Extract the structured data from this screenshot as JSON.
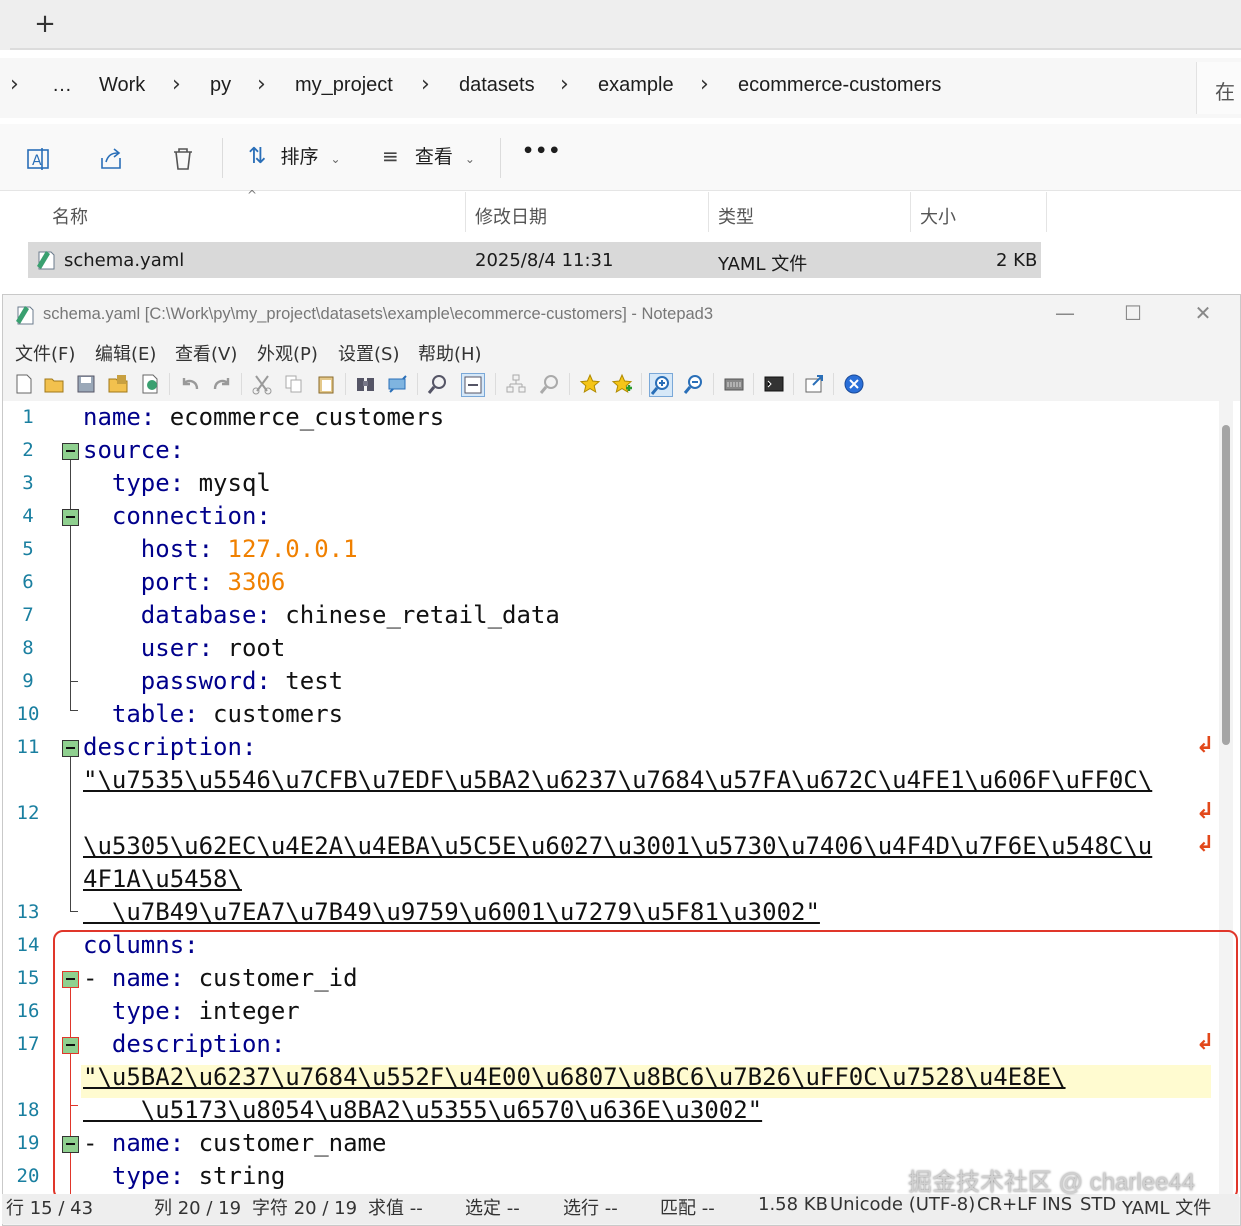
{
  "explorer": {
    "new_tab_label": "+",
    "breadcrumb": [
      "…",
      "Work",
      "py",
      "my_project",
      "datasets",
      "example",
      "ecommerce-customers"
    ],
    "address_right": "在",
    "commands": {
      "sort": "排序",
      "view": "查看",
      "more": "•••"
    },
    "columns": {
      "name": "名称",
      "modified": "修改日期",
      "type": "类型",
      "size": "大小"
    },
    "file": {
      "name": "schema.yaml",
      "modified": "2025/8/4 11:31",
      "type": "YAML 文件",
      "size": "2 KB"
    }
  },
  "notepad": {
    "title": "schema.yaml [C:\\Work\\py\\my_project\\datasets\\example\\ecommerce-customers] - Notepad3",
    "menu": [
      "文件(F)",
      "编辑(E)",
      "查看(V)",
      "外观(P)",
      "设置(S)",
      "帮助(H)"
    ],
    "line_numbers": [
      "1",
      "2",
      "3",
      "4",
      "5",
      "6",
      "7",
      "8",
      "9",
      "10",
      "11",
      "12",
      "13",
      "14",
      "15",
      "16",
      "17",
      "18",
      "19",
      "20"
    ],
    "lines": {
      "l1k": "name:",
      "l1v": " ecommerce_customers",
      "l2k": "source:",
      "l3k": "  type:",
      "l3v": " mysql",
      "l4k": "  connection:",
      "l5k": "    host:",
      "l5v": "127.0.0.1",
      "l6k": "    port:",
      "l6v": "3306",
      "l7k": "    database:",
      "l7v": " chinese_retail_data",
      "l8k": "    user:",
      "l8v": " root",
      "l9k": "    password:",
      "l9v": " test",
      "l10k": "  table:",
      "l10v": " customers",
      "l11k": "description:",
      "l11w1": "\"\\u7535\\u5546\\u7CFB\\u7EDF\\u5BA2\\u6237\\u7684\\u57FA\\u672C\\u4FE1\\u606F\\uFF0C\\",
      "l12w1": "\\u5305\\u62EC\\u4E2A\\u4EBA\\u5C5E\\u6027\\u3001\\u5730\\u7406\\u4F4D\\u7F6E\\u548C\\u",
      "l12w2": "4F1A\\u5458\\",
      "l13v": "  \\u7B49\\u7EA7\\u7B49\\u9759\\u6001\\u7279\\u5F81\\u3002\"",
      "l14k": "columns:",
      "l15d": "- ",
      "l15k": "name:",
      "l15v": " customer_id",
      "l16k": "  type:",
      "l16v": " integer",
      "l17k": "  description:",
      "l17w1": "\"\\u5BA2\\u6237\\u7684\\u552F\\u4E00\\u6807\\u8BC6\\u7B26\\uFF0C\\u7528\\u4E8E\\",
      "l18v": "    \\u5173\\u8054\\u8BA2\\u5355\\u6570\\u636E\\u3002\"",
      "l19d": "- ",
      "l19k": "name:",
      "l19v": " customer_name",
      "l20k": "  type:",
      "l20v": " string"
    },
    "status": {
      "line": "行 15 / 43",
      "col": "列 20 / 19",
      "char": "字符 20 / 19",
      "sum": "求值 --",
      "sel": "选定 --",
      "selline": "选行 --",
      "match": "匹配 --",
      "size": "1.58 KB",
      "encoding": "Unicode (UTF-8)",
      "eol": "CR+LF",
      "ins": "INS",
      "std": "STD",
      "filetype": "YAML 文件"
    }
  },
  "watermark": "掘金技术社区 @ charlee44",
  "colors": {
    "highlight_box": "#e0362a",
    "keyword": "#00008b",
    "number": "#f08000",
    "line_number": "#1a7fa0"
  }
}
